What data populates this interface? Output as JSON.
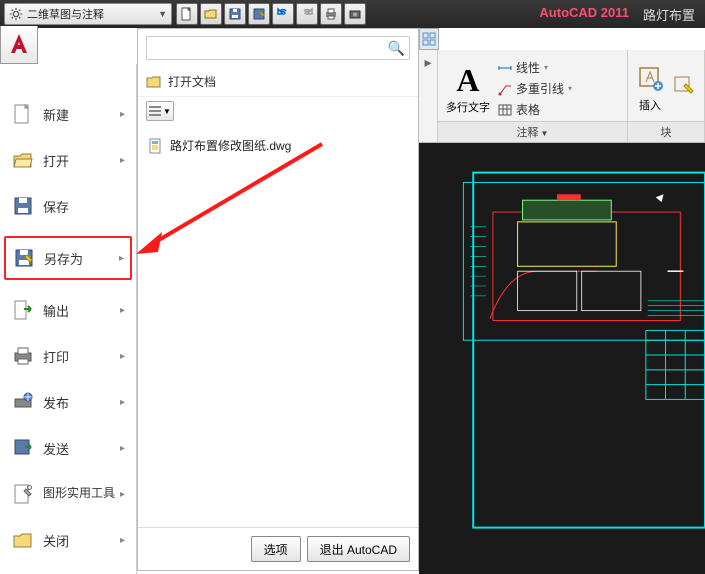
{
  "topbar": {
    "workspace": "二维草图与注释",
    "product": "AutoCAD 2011",
    "filename": "路灯布置"
  },
  "app_menu": {
    "items": [
      {
        "label": "新建",
        "icon": "new"
      },
      {
        "label": "打开",
        "icon": "open"
      },
      {
        "label": "保存",
        "icon": "save"
      },
      {
        "label": "另存为",
        "icon": "saveas",
        "highlight": true
      },
      {
        "label": "输出",
        "icon": "export"
      },
      {
        "label": "打印",
        "icon": "print"
      },
      {
        "label": "发布",
        "icon": "publish"
      },
      {
        "label": "发送",
        "icon": "send"
      },
      {
        "label": "图形实用工具",
        "icon": "tools"
      },
      {
        "label": "关闭",
        "icon": "close"
      }
    ]
  },
  "recent": {
    "header": "打开文档",
    "files": [
      {
        "name": "路灯布置修改图纸.dwg"
      }
    ],
    "footer": {
      "options": "选项",
      "exit": "退出 AutoCAD"
    }
  },
  "ribbon": {
    "mtext": {
      "big": "A",
      "label": "多行文字"
    },
    "annot_group": "注释",
    "rows": {
      "linetype": "线性",
      "multileader": "多重引线",
      "table": "表格"
    },
    "insert_group": "插入",
    "insert_label": "插入",
    "block_group": "块"
  }
}
